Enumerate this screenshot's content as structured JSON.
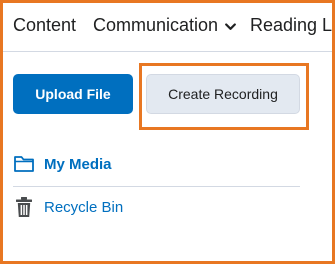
{
  "nav": {
    "tabs": [
      {
        "label": "Content"
      },
      {
        "label": "Communication"
      },
      {
        "label": "Reading Lis"
      }
    ],
    "chevron_icon": "chevron-down-icon"
  },
  "actions": {
    "upload_label": "Upload File",
    "create_recording_label": "Create Recording"
  },
  "library": {
    "items": [
      {
        "label": "My Media",
        "icon": "folder-icon"
      },
      {
        "label": "Recycle Bin",
        "icon": "trash-icon"
      }
    ]
  },
  "colors": {
    "accent": "#006fbf",
    "highlight": "#e87722",
    "secondary_button": "#e3e9f1"
  }
}
